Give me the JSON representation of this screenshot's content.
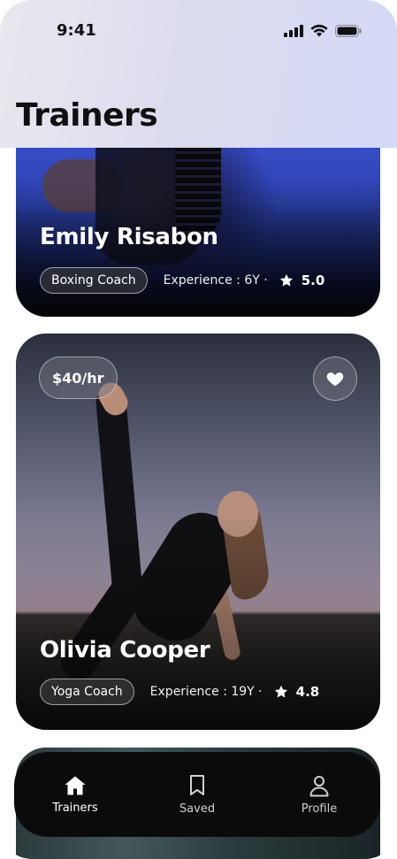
{
  "status_bar": {
    "time": "9:41",
    "icons": [
      "signal-icon",
      "wifi-icon",
      "battery-icon"
    ]
  },
  "header": {
    "title": "Trainers"
  },
  "trainers": [
    {
      "name": "Emily Risabon",
      "role": "Boxing Coach",
      "experience": "Experience : 6Y ·",
      "rating": "5.0"
    },
    {
      "name": "Olivia Cooper",
      "role": "Yoga Coach",
      "experience": "Experience : 19Y ·",
      "rating": "4.8",
      "price": "$40/hr",
      "favorite_icon": "heart-icon"
    }
  ],
  "tabbar": {
    "items": [
      {
        "label": "Trainers",
        "icon": "home-icon",
        "active": true
      },
      {
        "label": "Saved",
        "icon": "bookmark-icon",
        "active": false
      },
      {
        "label": "Profile",
        "icon": "user-icon",
        "active": false
      }
    ]
  },
  "colors": {
    "tabbar_background": "#0b0b0c",
    "header_gradient_end": "#d3d9f7",
    "text_primary": "#101010"
  }
}
